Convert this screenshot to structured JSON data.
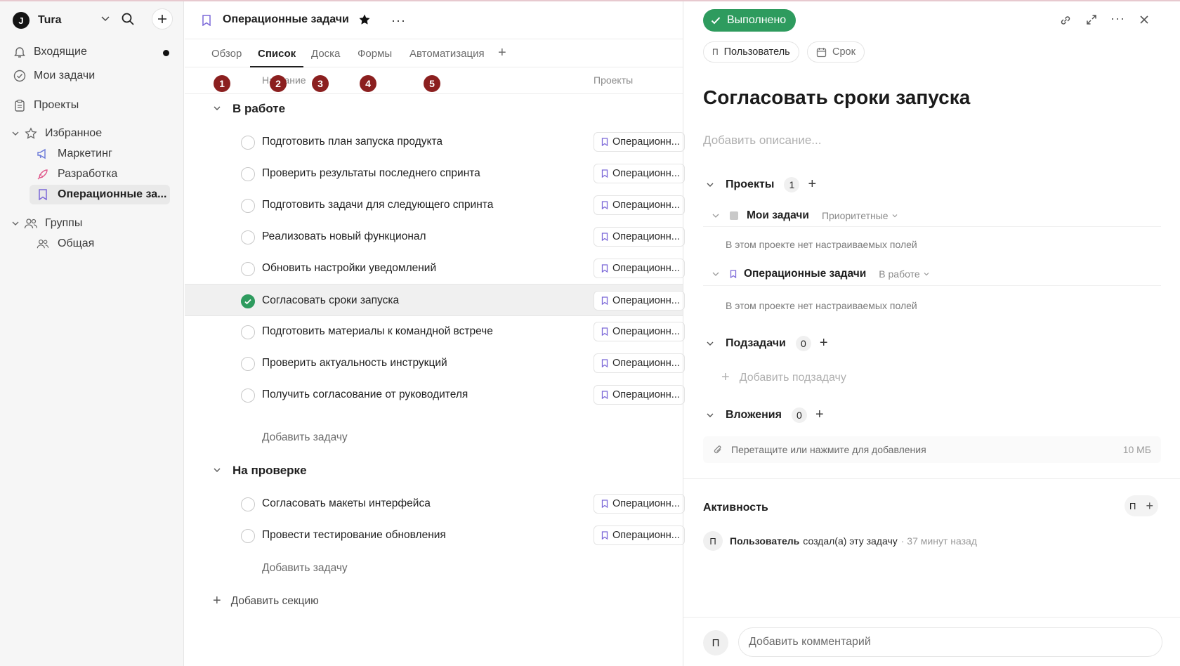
{
  "workspace": {
    "logo": "J",
    "name": "Tura"
  },
  "sidebar": {
    "inbox": "Входящие",
    "my_tasks": "Мои задачи",
    "projects": "Проекты",
    "favorites": "Избранное",
    "favorite_items": [
      "Маркетинг",
      "Разработка",
      "Операционные за..."
    ],
    "groups": "Группы",
    "group_items": [
      "Общая"
    ]
  },
  "header": {
    "project_title": "Операционные задачи"
  },
  "tabs": [
    "Обзор",
    "Список",
    "Доска",
    "Формы",
    "Автоматизация"
  ],
  "columns": {
    "name": "Название",
    "projects": "Проекты"
  },
  "badges": [
    "1",
    "2",
    "3",
    "4",
    "5"
  ],
  "sections": [
    {
      "title": "В работе",
      "tasks": [
        "Подготовить план запуска продукта",
        "Проверить результаты последнего спринта",
        "Подготовить задачи для следующего спринта",
        "Реализовать новый функционал",
        "Обновить настройки уведомлений",
        "Согласовать сроки запуска",
        "Подготовить материалы к командной встрече",
        "Проверить актуальность инструкций",
        "Получить согласование от руководителя"
      ],
      "add_task": "Добавить задачу"
    },
    {
      "title": "На проверке",
      "tasks": [
        "Согласовать макеты интерфейса",
        "Провести тестирование обновления"
      ],
      "add_task": "Добавить задачу"
    }
  ],
  "task_project_tag": "Операционн...",
  "add_section": "Добавить секцию",
  "detail": {
    "status_button": "Выполнено",
    "assignee_initial": "П",
    "assignee": "Пользователь",
    "due": "Срок",
    "title": "Согласовать сроки запуска",
    "description_placeholder": "Добавить описание...",
    "projects_label": "Проекты",
    "projects_count": "1",
    "my_tasks": "Мои задачи",
    "my_tasks_status": "Приоритетные",
    "no_fields": "В этом проекте нет настраиваемых полей",
    "op_project": "Операционные задачи",
    "op_status": "В работе",
    "subtasks_label": "Подзадачи",
    "subtasks_count": "0",
    "add_subtask": "Добавить подзадачу",
    "attachments_label": "Вложения",
    "attachments_count": "0",
    "dropzone": "Перетащите или нажмите для добавления",
    "dropzone_size": "10 МБ",
    "activity": "Активность",
    "activity_initial": "П",
    "activity_user": "Пользователь",
    "activity_action": "создал(а) эту задачу",
    "activity_time": "· 37 минут назад",
    "comment_initial": "П",
    "comment_placeholder": "Добавить комментарий"
  },
  "colors": {
    "done_green": "#2e9b5e",
    "badge_red": "#8b1f1f",
    "bookmark_purple": "#7b68d8"
  }
}
